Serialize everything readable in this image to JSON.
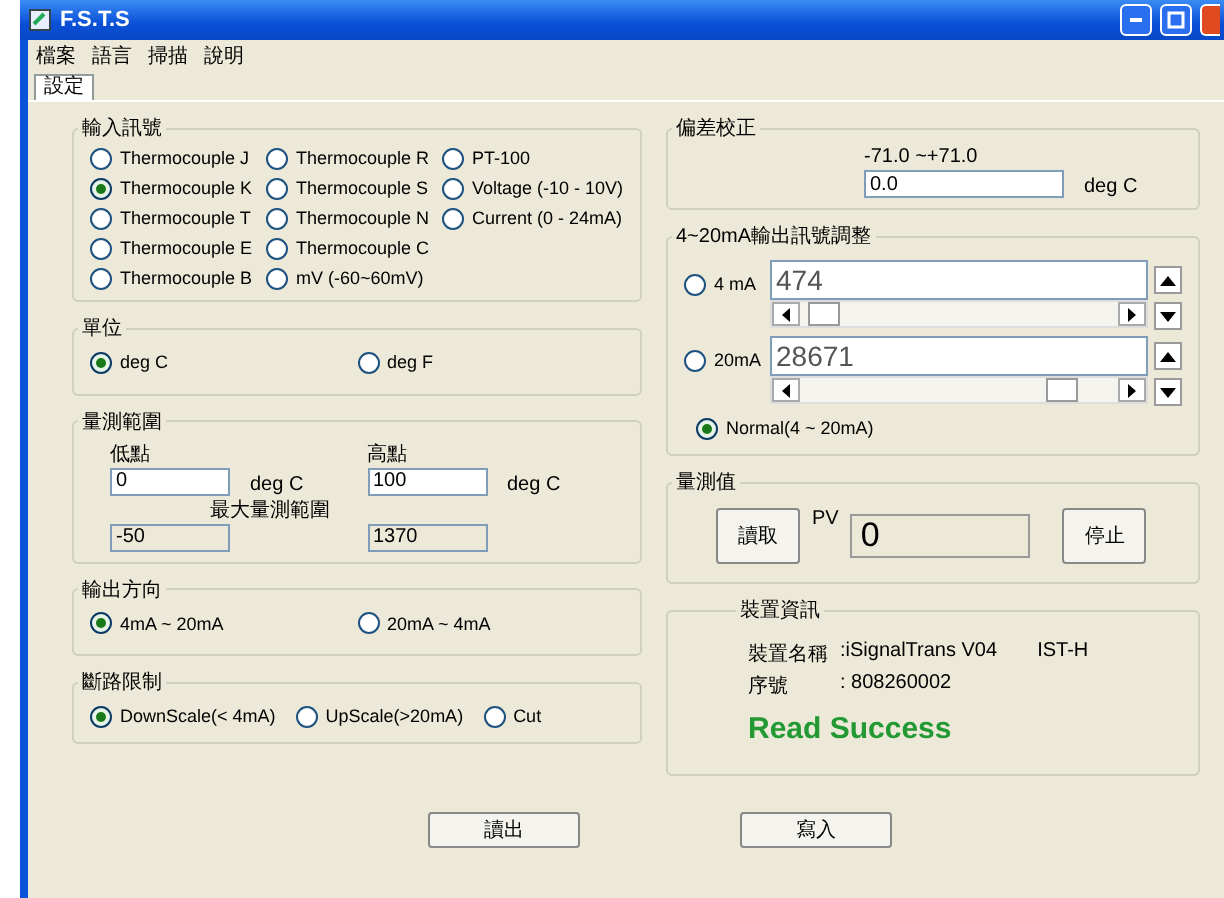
{
  "window": {
    "title": "F.S.T.S"
  },
  "menu": [
    "檔案",
    "語言",
    "掃描",
    "說明"
  ],
  "tabs": [
    {
      "label": "設定",
      "selected": true
    }
  ],
  "input_signal": {
    "title": "輸入訊號",
    "columns": [
      [
        {
          "label": "Thermocouple J",
          "selected": false
        },
        {
          "label": "Thermocouple K",
          "selected": true
        },
        {
          "label": "Thermocouple T",
          "selected": false
        },
        {
          "label": "Thermocouple E",
          "selected": false
        },
        {
          "label": "Thermocouple B",
          "selected": false
        }
      ],
      [
        {
          "label": "Thermocouple R",
          "selected": false
        },
        {
          "label": "Thermocouple S",
          "selected": false
        },
        {
          "label": "Thermocouple N",
          "selected": false
        },
        {
          "label": "Thermocouple C",
          "selected": false
        },
        {
          "label": "mV (-60~60mV)",
          "selected": false
        }
      ],
      [
        {
          "label": "PT-100",
          "selected": false
        },
        {
          "label": "Voltage (-10 - 10V)",
          "selected": false
        },
        {
          "label": "Current (0 - 24mA)",
          "selected": false
        }
      ]
    ]
  },
  "unit": {
    "title": "單位",
    "options": [
      {
        "label": "deg C",
        "selected": true
      },
      {
        "label": "deg F",
        "selected": false
      }
    ]
  },
  "range": {
    "title": "量測範圍",
    "low_label": "低點",
    "high_label": "高點",
    "low_value": "0",
    "high_value": "100",
    "low_unit": "deg C",
    "high_unit": "deg C",
    "max_label": "最大量測範圍",
    "max_low": "-50",
    "max_high": "1370"
  },
  "output_direction": {
    "title": "輸出方向",
    "options": [
      {
        "label": "4mA ~ 20mA",
        "selected": true
      },
      {
        "label": "20mA ~ 4mA",
        "selected": false
      }
    ]
  },
  "break_limit": {
    "title": "斷路限制",
    "options": [
      {
        "label": "DownScale(< 4mA)",
        "selected": true
      },
      {
        "label": "UpScale(>20mA)",
        "selected": false
      },
      {
        "label": "Cut",
        "selected": false
      }
    ]
  },
  "offset": {
    "title": "偏差校正",
    "range": "-71.0 ~+71.0",
    "value": "0.0",
    "unit": "deg C"
  },
  "adjust": {
    "title": "4~20mA輸出訊號調整",
    "options": [
      {
        "kind": "slider",
        "label": "4 mA",
        "selected": false,
        "value": "474",
        "level": 0.03
      },
      {
        "kind": "slider",
        "label": "20mA",
        "selected": false,
        "value": "28671",
        "level": 0.86
      },
      {
        "kind": "plain",
        "label": "Normal(4 ~ 20mA)",
        "selected": true
      }
    ]
  },
  "measure": {
    "title": "量測值",
    "read_button": "讀取",
    "pv_label": "PV",
    "pv_value": "0",
    "stop_button": "停止"
  },
  "device": {
    "title": "裝置資訊",
    "rows": [
      {
        "label": "裝置名稱",
        "value": ":iSignalTrans V04",
        "extra": "IST-H"
      },
      {
        "label": "序號",
        "value": ":  808260002"
      }
    ],
    "status": "Read Success"
  },
  "buttons": [
    "讀出",
    "寫入"
  ]
}
